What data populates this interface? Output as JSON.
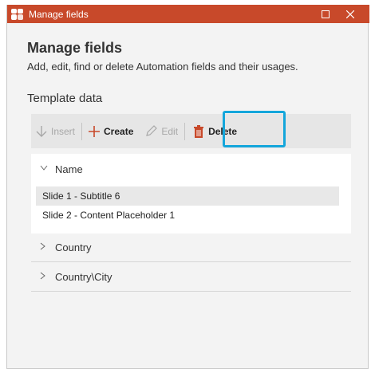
{
  "window": {
    "title": "Manage fields"
  },
  "header": {
    "title": "Manage fields",
    "subtitle": "Add, edit, find or delete Automation fields and their usages."
  },
  "section": {
    "title": "Template data"
  },
  "toolbar": {
    "insert_label": "Insert",
    "create_label": "Create",
    "edit_label": "Edit",
    "delete_label": "Delete"
  },
  "tree": {
    "groups": [
      {
        "label": "Name",
        "expanded": true,
        "children": [
          "Slide 1 - Subtitle 6",
          "Slide 2 - Content Placeholder 1"
        ]
      },
      {
        "label": "Country",
        "expanded": false
      },
      {
        "label": "Country\\City",
        "expanded": false
      }
    ]
  },
  "colors": {
    "titlebar": "#c8492a",
    "highlight": "#14a6db",
    "delete_icon": "#c8492a"
  },
  "icons": {
    "insert": "arrow-down-icon",
    "create": "plus-icon",
    "edit": "pencil-icon",
    "delete": "trash-icon",
    "minimize": "maximize-icon",
    "close": "close-icon"
  }
}
